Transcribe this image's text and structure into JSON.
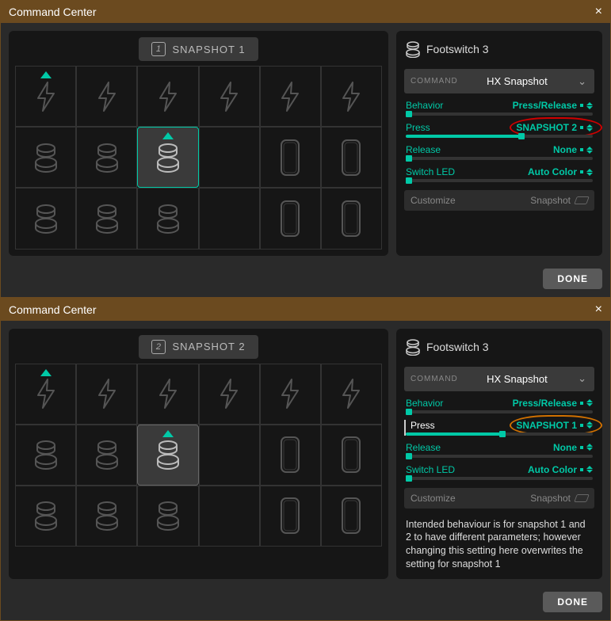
{
  "windows": [
    {
      "title": "Command Center",
      "snapshot": {
        "num": "1",
        "label": "SNAPSHOT 1"
      },
      "panel": {
        "title": "Footswitch 3",
        "command_label": "COMMAND",
        "command_value": "HX Snapshot",
        "params": {
          "behavior": {
            "label": "Behavior",
            "value": "Press/Release"
          },
          "press": {
            "label": "Press",
            "value": "SNAPSHOT 2"
          },
          "release": {
            "label": "Release",
            "value": "None"
          },
          "led": {
            "label": "Switch LED",
            "value": "Auto Color"
          }
        },
        "customize": {
          "label": "Customize",
          "value": "Snapshot"
        }
      },
      "circle_color": "#d00000",
      "done": "DONE"
    },
    {
      "title": "Command Center",
      "snapshot": {
        "num": "2",
        "label": "SNAPSHOT 2"
      },
      "panel": {
        "title": "Footswitch 3",
        "command_label": "COMMAND",
        "command_value": "HX Snapshot",
        "params": {
          "behavior": {
            "label": "Behavior",
            "value": "Press/Release"
          },
          "press": {
            "label": "Press",
            "value": "SNAPSHOT 1"
          },
          "release": {
            "label": "Release",
            "value": "None"
          },
          "led": {
            "label": "Switch LED",
            "value": "Auto Color"
          }
        },
        "customize": {
          "label": "Customize",
          "value": "Snapshot"
        }
      },
      "circle_color": "#d07000",
      "note": "Intended behaviour is for snapshot 1 and 2 to have different parameters; however changing this setting here overwrites the setting for snapshot 1",
      "done": "DONE"
    }
  ],
  "slider_fills": {
    "behavior": "4%",
    "press_a": "60%",
    "press_b": "50%",
    "release": "2%",
    "led": "4%"
  }
}
